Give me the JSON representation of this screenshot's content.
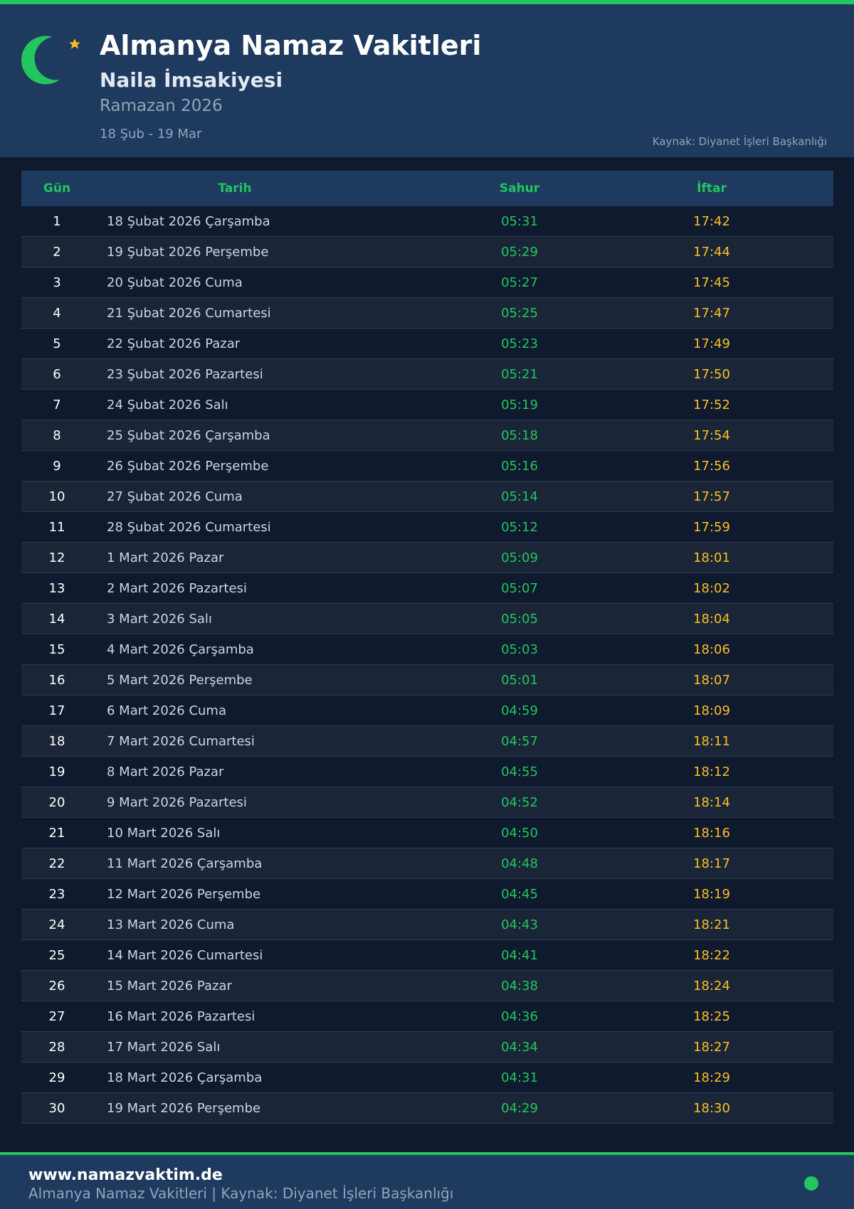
{
  "header": {
    "title": "Almanya Namaz Vakitleri",
    "subtitle": "Naila İmsakiyesi",
    "season": "Ramazan 2026",
    "date_range": "18 Şub - 19 Mar",
    "source": "Kaynak: Diyanet İşleri Başkanlığı",
    "logo_icon": "crescent-star-icon"
  },
  "colors": {
    "accent_green": "#22c55e",
    "iftar_gold": "#fbbf24",
    "header_bg": "#1e3a5f",
    "page_bg": "#0f1a2e"
  },
  "table": {
    "columns": [
      "Gün",
      "Tarih",
      "Sahur",
      "İftar"
    ],
    "rows": [
      [
        "1",
        "18 Şubat 2026 Çarşamba",
        "05:31",
        "17:42"
      ],
      [
        "2",
        "19 Şubat 2026 Perşembe",
        "05:29",
        "17:44"
      ],
      [
        "3",
        "20 Şubat 2026 Cuma",
        "05:27",
        "17:45"
      ],
      [
        "4",
        "21 Şubat 2026 Cumartesi",
        "05:25",
        "17:47"
      ],
      [
        "5",
        "22 Şubat 2026 Pazar",
        "05:23",
        "17:49"
      ],
      [
        "6",
        "23 Şubat 2026 Pazartesi",
        "05:21",
        "17:50"
      ],
      [
        "7",
        "24 Şubat 2026 Salı",
        "05:19",
        "17:52"
      ],
      [
        "8",
        "25 Şubat 2026 Çarşamba",
        "05:18",
        "17:54"
      ],
      [
        "9",
        "26 Şubat 2026 Perşembe",
        "05:16",
        "17:56"
      ],
      [
        "10",
        "27 Şubat 2026 Cuma",
        "05:14",
        "17:57"
      ],
      [
        "11",
        "28 Şubat 2026 Cumartesi",
        "05:12",
        "17:59"
      ],
      [
        "12",
        "1 Mart 2026 Pazar",
        "05:09",
        "18:01"
      ],
      [
        "13",
        "2 Mart 2026 Pazartesi",
        "05:07",
        "18:02"
      ],
      [
        "14",
        "3 Mart 2026 Salı",
        "05:05",
        "18:04"
      ],
      [
        "15",
        "4 Mart 2026 Çarşamba",
        "05:03",
        "18:06"
      ],
      [
        "16",
        "5 Mart 2026 Perşembe",
        "05:01",
        "18:07"
      ],
      [
        "17",
        "6 Mart 2026 Cuma",
        "04:59",
        "18:09"
      ],
      [
        "18",
        "7 Mart 2026 Cumartesi",
        "04:57",
        "18:11"
      ],
      [
        "19",
        "8 Mart 2026 Pazar",
        "04:55",
        "18:12"
      ],
      [
        "20",
        "9 Mart 2026 Pazartesi",
        "04:52",
        "18:14"
      ],
      [
        "21",
        "10 Mart 2026 Salı",
        "04:50",
        "18:16"
      ],
      [
        "22",
        "11 Mart 2026 Çarşamba",
        "04:48",
        "18:17"
      ],
      [
        "23",
        "12 Mart 2026 Perşembe",
        "04:45",
        "18:19"
      ],
      [
        "24",
        "13 Mart 2026 Cuma",
        "04:43",
        "18:21"
      ],
      [
        "25",
        "14 Mart 2026 Cumartesi",
        "04:41",
        "18:22"
      ],
      [
        "26",
        "15 Mart 2026 Pazar",
        "04:38",
        "18:24"
      ],
      [
        "27",
        "16 Mart 2026 Pazartesi",
        "04:36",
        "18:25"
      ],
      [
        "28",
        "17 Mart 2026 Salı",
        "04:34",
        "18:27"
      ],
      [
        "29",
        "18 Mart 2026 Çarşamba",
        "04:31",
        "18:29"
      ],
      [
        "30",
        "19 Mart 2026 Perşembe",
        "04:29",
        "18:30"
      ]
    ]
  },
  "footer": {
    "site": "www.namazvaktim.de",
    "text": "Almanya Namaz Vakitleri | Kaynak: Diyanet İşleri Başkanlığı",
    "indicator_icon": "status-dot-icon"
  }
}
